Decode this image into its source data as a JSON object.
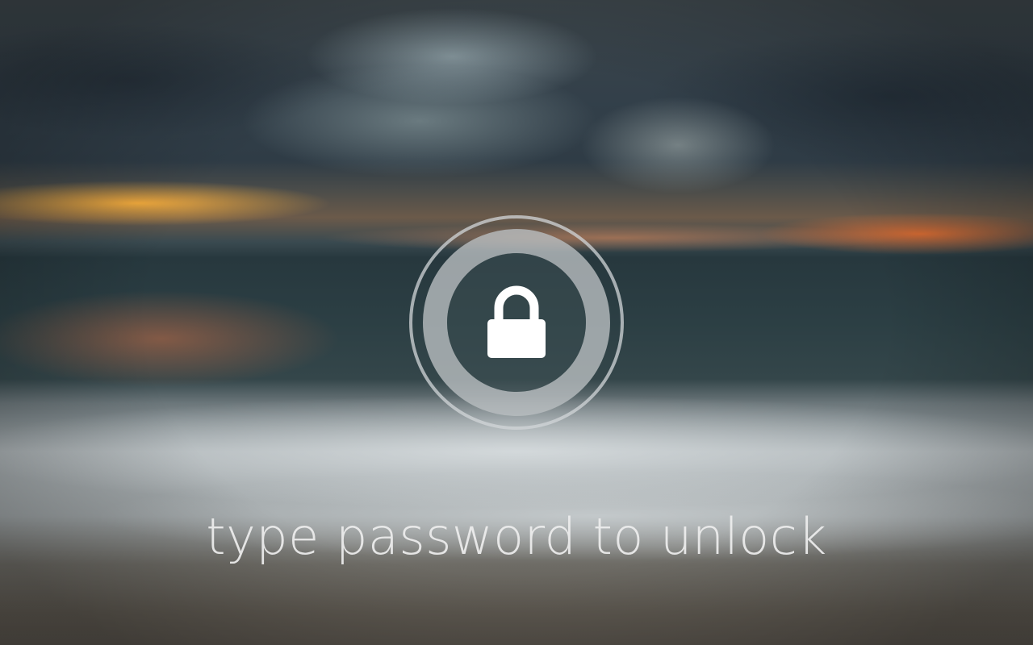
{
  "lockscreen": {
    "prompt": "type password to unlock",
    "icon": "padlock-icon"
  },
  "colors": {
    "prompt_text": "#eeeeee",
    "lock_icon": "#ffffff",
    "ring": "#d2d6d8"
  }
}
